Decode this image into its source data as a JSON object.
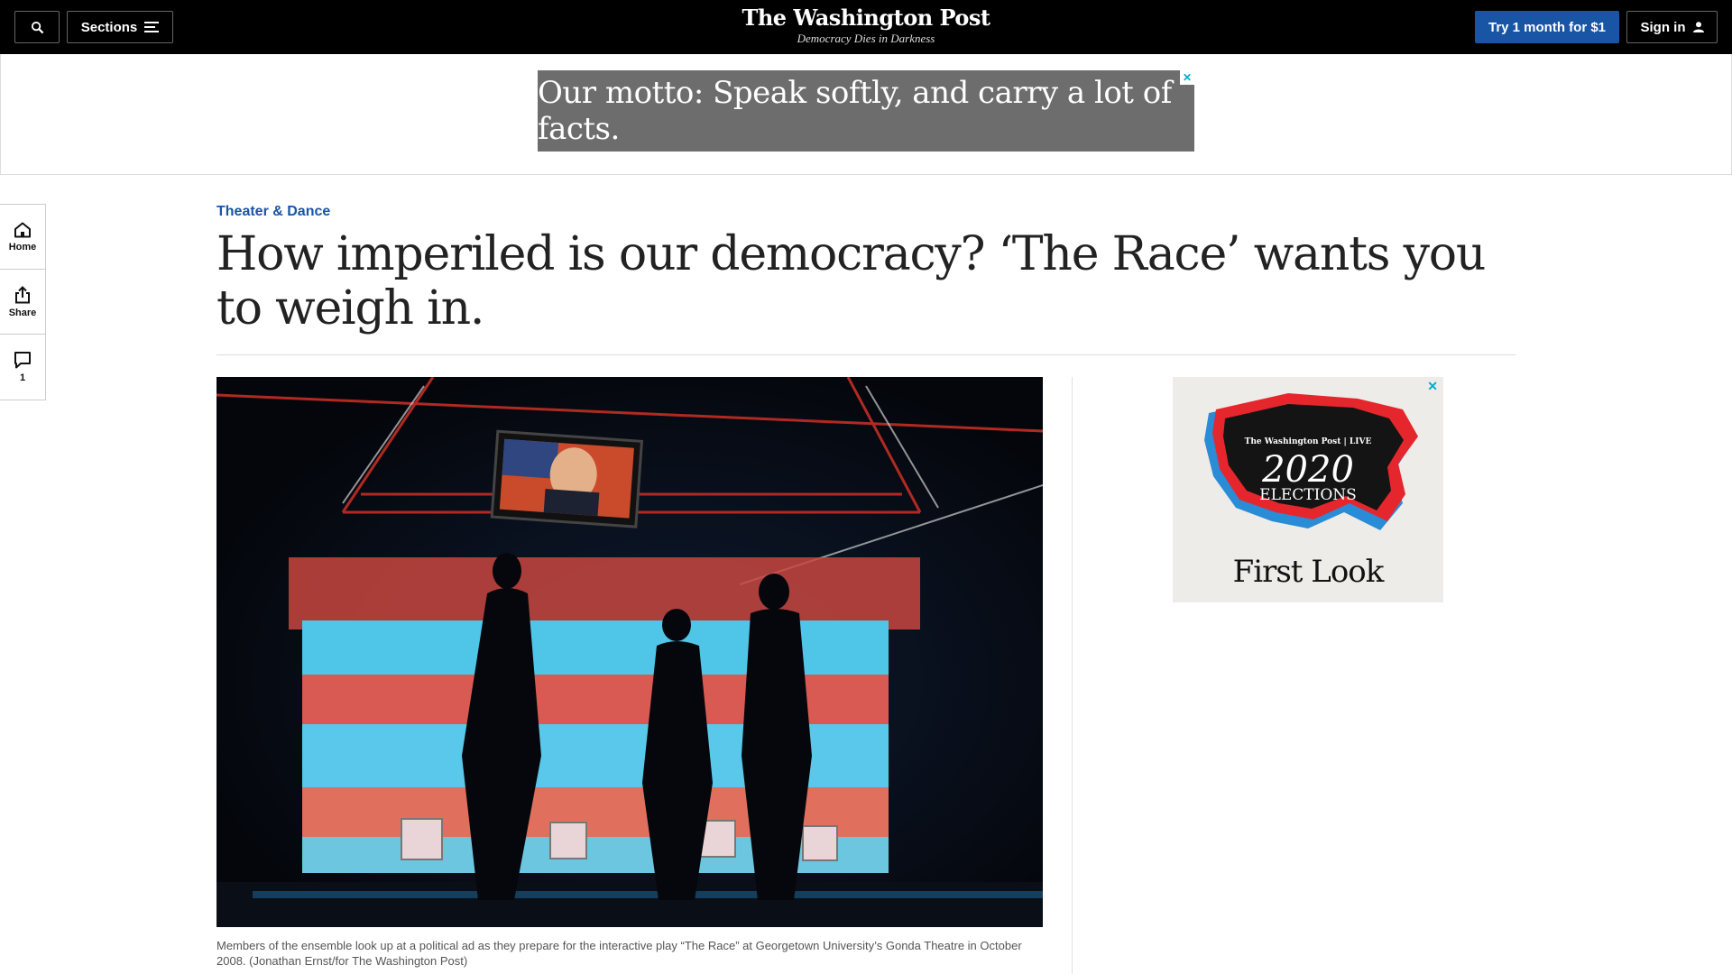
{
  "nav": {
    "sections_label": "Sections",
    "masthead_title": "The Washington Post",
    "masthead_tagline": "Democracy Dies in Darkness",
    "subscribe_label": "Try 1 month for $1",
    "signin_label": "Sign in"
  },
  "top_ad": {
    "text": "Our motto: Speak softly, and carry a lot of facts."
  },
  "siderail": {
    "home_label": "Home",
    "share_label": "Share",
    "comments_count": "1"
  },
  "article": {
    "kicker": "Theater & Dance",
    "headline": "How imperiled is our democracy? ‘The Race’ wants you to weigh in.",
    "caption": "Members of the ensemble look up at a political ad as they prepare for the interactive play “The Race” at Georgetown University’s Gonda Theatre in October 2008. (Jonathan Ernst/for The Washington Post)"
  },
  "right_ad": {
    "brand": "The Washington Post | LIVE",
    "year": "2020",
    "event": "ELECTIONS",
    "title": "First Look"
  },
  "colors": {
    "nav_bg": "#000000",
    "accent_blue": "#1955a5",
    "ad_gray": "#6d6d6d"
  }
}
